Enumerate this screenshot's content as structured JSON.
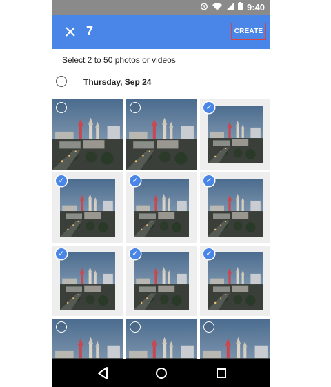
{
  "status_bar": {
    "time": "9:40",
    "icons": [
      "alarm-icon",
      "wifi-icon",
      "signal-icon",
      "battery-icon"
    ]
  },
  "toolbar": {
    "close_icon": "close-icon",
    "selected_count": "7",
    "create_label": "CREATE",
    "background": "#4a86e8"
  },
  "instruction": "Select 2 to 50 photos or videos",
  "date_group": {
    "label": "Thursday, Sep 24"
  },
  "photos": [
    {
      "selected": false
    },
    {
      "selected": false
    },
    {
      "selected": true
    },
    {
      "selected": true
    },
    {
      "selected": true
    },
    {
      "selected": true
    },
    {
      "selected": true
    },
    {
      "selected": true
    },
    {
      "selected": true
    },
    {
      "selected": false
    },
    {
      "selected": false
    },
    {
      "selected": false
    }
  ],
  "nav_bar": {
    "icons": [
      "back-icon",
      "home-icon",
      "recents-icon"
    ]
  },
  "colors": {
    "accent": "#4a86e8",
    "status_bar": "#8a8a8a",
    "create_outline": "#d64545"
  }
}
